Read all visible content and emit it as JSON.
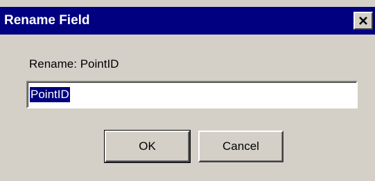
{
  "window": {
    "title": "Rename Field"
  },
  "close_icon": "close-x",
  "prompt": {
    "label": "Rename: PointID"
  },
  "field": {
    "value": "PointID",
    "selected": true
  },
  "buttons": {
    "ok_label": "OK",
    "cancel_label": "Cancel"
  },
  "colors": {
    "title_bar": "#000080",
    "face": "#d4d0c8",
    "selection": "#000080"
  }
}
